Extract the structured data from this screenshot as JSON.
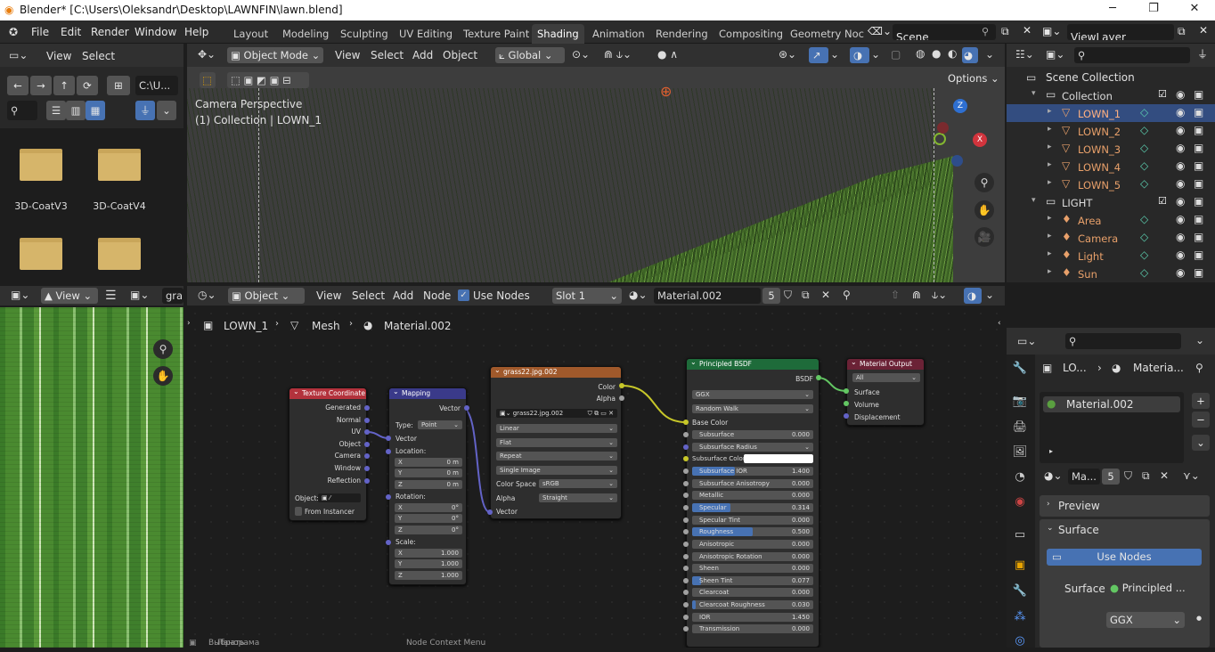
{
  "window": {
    "title": "Blender* [C:\\Users\\Oleksandr\\Desktop\\LAWNFIN\\lawn.blend]",
    "minimize": "─",
    "maximize": "❐",
    "close": "✕"
  },
  "menu": {
    "file": "File",
    "edit": "Edit",
    "render": "Render",
    "window": "Window",
    "help": "Help"
  },
  "workspaces": [
    "Layout",
    "Modeling",
    "Sculpting",
    "UV Editing",
    "Texture Paint",
    "Shading",
    "Animation",
    "Rendering",
    "Compositing",
    "Geometry Noc"
  ],
  "active_workspace": "Shading",
  "scene": {
    "name": "Scene",
    "view_layer": "ViewLayer"
  },
  "file_browser": {
    "view": "View",
    "select": "Select",
    "path": "C:\\U...",
    "folders": [
      "3D-CoatV3",
      "3D-CoatV4",
      "",
      ""
    ]
  },
  "viewport": {
    "mode": "Object Mode",
    "view": "View",
    "select": "Select",
    "add": "Add",
    "object": "Object",
    "transform": "Global",
    "options": "Options",
    "camera_label": "Camera Perspective",
    "collection_label": "(1) Collection | LOWN_1"
  },
  "image_editor": {
    "view": "View",
    "image_name": "gra"
  },
  "node_editor": {
    "editor": "Object",
    "view": "View",
    "select": "Select",
    "add": "Add",
    "node": "Node",
    "use_nodes": "Use Nodes",
    "slot": "Slot 1",
    "material": "Material.002",
    "users": "5",
    "breadcrumb": {
      "object": "LOWN_1",
      "mesh": "Mesh",
      "material": "Material.002"
    },
    "status_left": "Выбрать",
    "status_mid": "Панорама",
    "status_right": "Node Context Menu"
  },
  "nodes": {
    "texcoord": {
      "title": "Texture Coordinate",
      "outputs": [
        "Generated",
        "Normal",
        "UV",
        "Object",
        "Camera",
        "Window",
        "Reflection"
      ],
      "object_label": "Object:",
      "from_instancer": "From Instancer"
    },
    "mapping": {
      "title": "Mapping",
      "output": "Vector",
      "type_label": "Type:",
      "type_value": "Point",
      "input_vector": "Vector",
      "location": "Location:",
      "loc": [
        "0 m",
        "0 m",
        "0 m"
      ],
      "rotation": "Rotation:",
      "rot": [
        "0°",
        "0°",
        "0°"
      ],
      "scale": "Scale:",
      "scl": [
        "1.000",
        "1.000",
        "1.000"
      ],
      "axes": [
        "X",
        "Y",
        "Z"
      ]
    },
    "image": {
      "title": "grass22.jpg.002",
      "out_color": "Color",
      "out_alpha": "Alpha",
      "img_name": "grass22.jpg.002",
      "interp": "Linear",
      "proj": "Flat",
      "ext": "Repeat",
      "source": "Single Image",
      "cs_label": "Color Space",
      "cs_value": "sRGB",
      "alpha_label": "Alpha",
      "alpha_value": "Straight",
      "in_vector": "Vector"
    },
    "bsdf": {
      "title": "Principled BSDF",
      "output": "BSDF",
      "distribution": "GGX",
      "sss_method": "Random Walk",
      "base_color": "Base Color",
      "fields": [
        {
          "label": "Subsurface",
          "value": "0.000",
          "fill": 0
        },
        {
          "label": "Subsurface Radius",
          "value": "",
          "fill": 0
        },
        {
          "label": "Subsurface Color",
          "value": "",
          "fill": 0
        },
        {
          "label": "Subsurface IOR",
          "value": "1.400",
          "fill": 0.35
        },
        {
          "label": "Subsurface Anisotropy",
          "value": "0.000",
          "fill": 0
        },
        {
          "label": "Metallic",
          "value": "0.000",
          "fill": 0
        },
        {
          "label": "Specular",
          "value": "0.314",
          "fill": 0.314
        },
        {
          "label": "Specular Tint",
          "value": "0.000",
          "fill": 0
        },
        {
          "label": "Roughness",
          "value": "0.500",
          "fill": 0.5
        },
        {
          "label": "Anisotropic",
          "value": "0.000",
          "fill": 0
        },
        {
          "label": "Anisotropic Rotation",
          "value": "0.000",
          "fill": 0
        },
        {
          "label": "Sheen",
          "value": "0.000",
          "fill": 0
        },
        {
          "label": "Sheen Tint",
          "value": "0.077",
          "fill": 0.077
        },
        {
          "label": "Clearcoat",
          "value": "0.000",
          "fill": 0
        },
        {
          "label": "Clearcoat Roughness",
          "value": "0.030",
          "fill": 0.03
        },
        {
          "label": "IOR",
          "value": "1.450",
          "fill": 0
        },
        {
          "label": "Transmission",
          "value": "0.000",
          "fill": 0
        }
      ]
    },
    "output": {
      "title": "Material Output",
      "target": "All",
      "inputs": [
        "Surface",
        "Volume",
        "Displacement"
      ]
    }
  },
  "outliner": {
    "scene_collection": "Scene Collection",
    "items": [
      {
        "name": "Collection",
        "level": 1,
        "sel": false
      },
      {
        "name": "LOWN_1",
        "level": 2,
        "sel": true
      },
      {
        "name": "LOWN_2",
        "level": 2,
        "sel": false
      },
      {
        "name": "LOWN_3",
        "level": 2,
        "sel": false
      },
      {
        "name": "LOWN_4",
        "level": 2,
        "sel": false
      },
      {
        "name": "LOWN_5",
        "level": 2,
        "sel": false
      },
      {
        "name": "LIGHT",
        "level": 1,
        "sel": false
      },
      {
        "name": "Area",
        "level": 2,
        "sel": false
      },
      {
        "name": "Camera",
        "level": 2,
        "sel": false
      },
      {
        "name": "Light",
        "level": 2,
        "sel": false
      },
      {
        "name": "Sun",
        "level": 2,
        "sel": false
      }
    ]
  },
  "properties": {
    "crumb_obj": "LO...",
    "crumb_mat": "Materia...",
    "slot_material": "Material.002",
    "mat_short": "Ma...",
    "mat_users": "5",
    "preview": "Preview",
    "surface": "Surface",
    "use_nodes": "Use Nodes",
    "surface_label": "Surface",
    "surface_value": "Principled ...",
    "ggx": "GGX"
  }
}
